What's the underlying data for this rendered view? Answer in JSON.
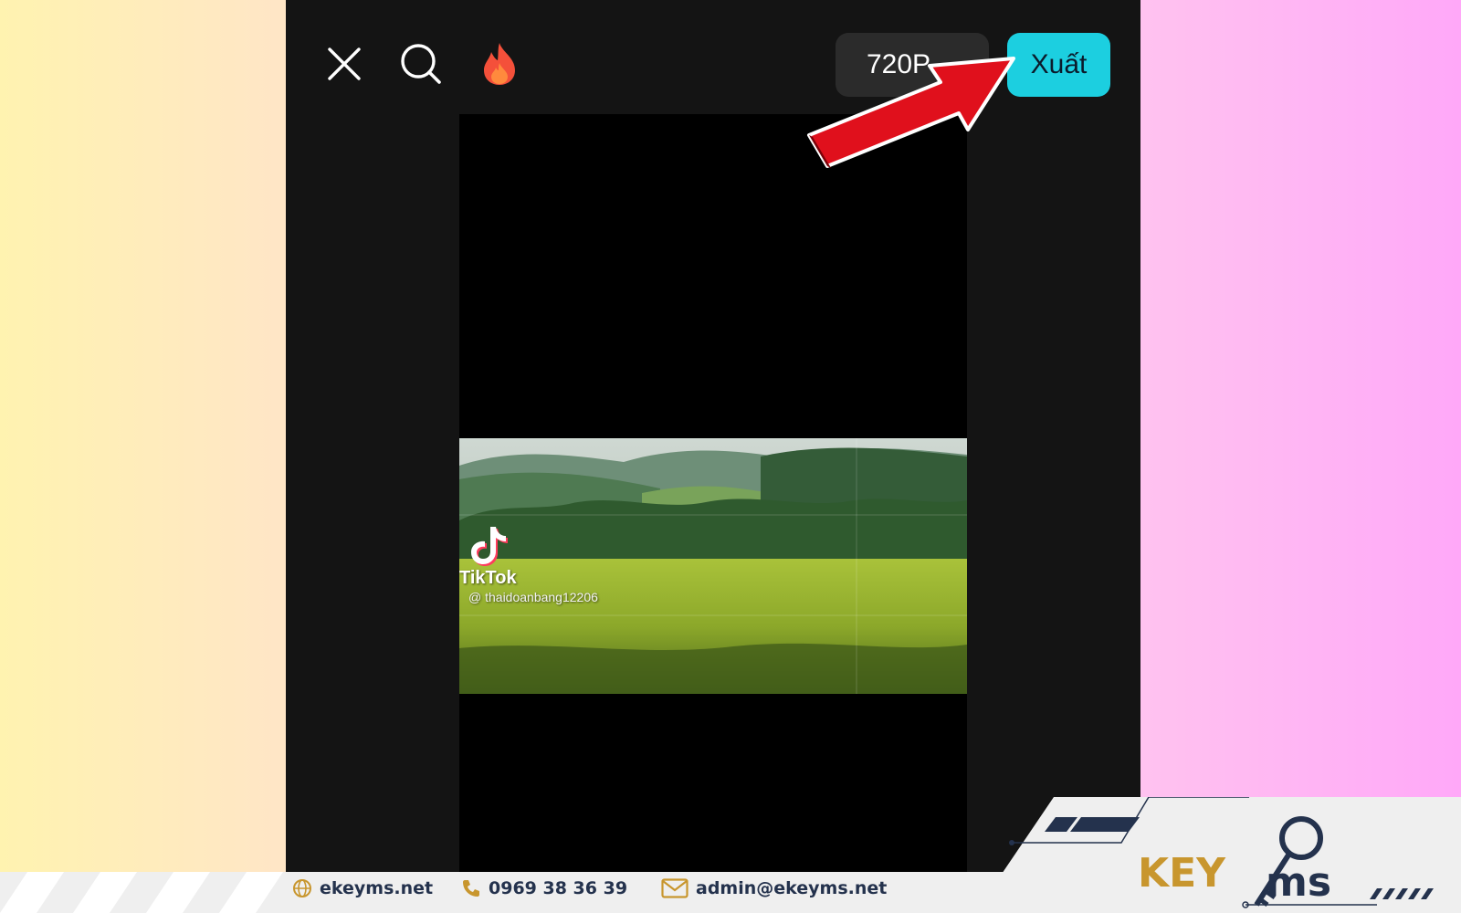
{
  "toolbar": {
    "close_icon": "close-icon",
    "search_icon": "search-icon",
    "flame_icon": "flame-icon",
    "resolution_label": "720P",
    "export_label": "Xuất"
  },
  "video": {
    "watermark_brand": "TikTok",
    "watermark_handle": "@ thaidoanbang12206"
  },
  "footer": {
    "website": "ekeyms.net",
    "phone": "0969 38 36 39",
    "email": "admin@ekeyms.net",
    "logo_text": "KEYMS"
  },
  "colors": {
    "export_button": "#1ccfe0",
    "arrow": "#e0101c",
    "brand_navy": "#24324d",
    "brand_gold": "#c8962e"
  }
}
